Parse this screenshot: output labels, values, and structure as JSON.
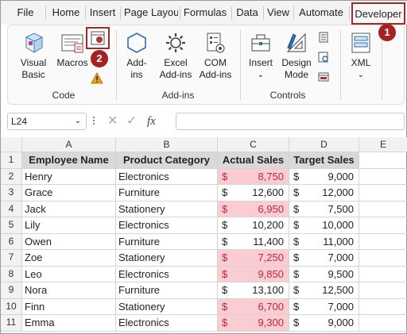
{
  "tabs": [
    "File",
    "Home",
    "Insert",
    "Page Layout",
    "Formulas",
    "Data",
    "View",
    "Automate",
    "Developer"
  ],
  "ribbon": {
    "code": {
      "group_label": "Code",
      "visual_basic": [
        "Visual",
        "Basic"
      ],
      "macros": "Macros"
    },
    "addins": {
      "group_label": "Add-ins",
      "addins": [
        "Add-",
        "ins"
      ],
      "excel_addins": [
        "Excel",
        "Add-ins"
      ],
      "com_addins": [
        "COM",
        "Add-ins"
      ]
    },
    "controls": {
      "group_label": "Controls",
      "insert": "Insert",
      "design_mode": [
        "Design",
        "Mode"
      ]
    },
    "xml": {
      "label": "XML"
    }
  },
  "badges": [
    "1",
    "2"
  ],
  "formula_bar": {
    "name_box": "L24",
    "fx": "fx",
    "formula": ""
  },
  "columns": [
    "A",
    "B",
    "C",
    "D",
    "E"
  ],
  "rows": [
    "1",
    "2",
    "3",
    "4",
    "5",
    "6",
    "7",
    "8",
    "9",
    "10",
    "11"
  ],
  "table": {
    "headers": [
      "Employee Name",
      "Product Category",
      "Actual Sales",
      "Target Sales"
    ],
    "currency": "$",
    "records": [
      {
        "name": "Henry",
        "category": "Electronics",
        "actual": "8,750",
        "target": "9,000",
        "below": true
      },
      {
        "name": "Grace",
        "category": "Furniture",
        "actual": "12,600",
        "target": "12,000",
        "below": false
      },
      {
        "name": "Jack",
        "category": "Stationery",
        "actual": "6,950",
        "target": "7,500",
        "below": true
      },
      {
        "name": "Lily",
        "category": "Electronics",
        "actual": "10,200",
        "target": "10,000",
        "below": false
      },
      {
        "name": "Owen",
        "category": "Furniture",
        "actual": "11,400",
        "target": "11,000",
        "below": false
      },
      {
        "name": "Zoe",
        "category": "Stationery",
        "actual": "7,250",
        "target": "7,000",
        "below": true
      },
      {
        "name": "Leo",
        "category": "Electronics",
        "actual": "9,850",
        "target": "9,500",
        "below": true
      },
      {
        "name": "Nora",
        "category": "Furniture",
        "actual": "13,100",
        "target": "12,500",
        "below": false
      },
      {
        "name": "Finn",
        "category": "Stationery",
        "actual": "6,700",
        "target": "7,000",
        "below": true
      },
      {
        "name": "Emma",
        "category": "Electronics",
        "actual": "9,300",
        "target": "9,000",
        "below": true
      }
    ]
  },
  "colors": {
    "highlight_fill": "#fbcdd3",
    "highlight_text": "#c0283a",
    "badge": "#a52222",
    "header_fill": "#d9d9d9"
  }
}
